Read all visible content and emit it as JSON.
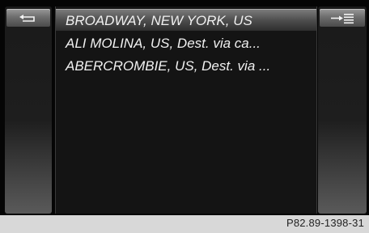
{
  "left_panel": {
    "back_icon": "back-arrow-icon"
  },
  "right_panel": {
    "menu_icon": "list-menu-icon"
  },
  "list": {
    "items": [
      {
        "label": "BROADWAY, NEW YORK, US",
        "selected": true
      },
      {
        "label": "ALI MOLINA, US, Dest. via ca...",
        "selected": false
      },
      {
        "label": "ABERCROMBIE, US, Dest. via ...",
        "selected": false
      }
    ]
  },
  "caption": "P82.89-1398-31",
  "colors": {
    "screen": "#050505",
    "selection": "#5e5e5e",
    "text": "#f0f0f0"
  }
}
